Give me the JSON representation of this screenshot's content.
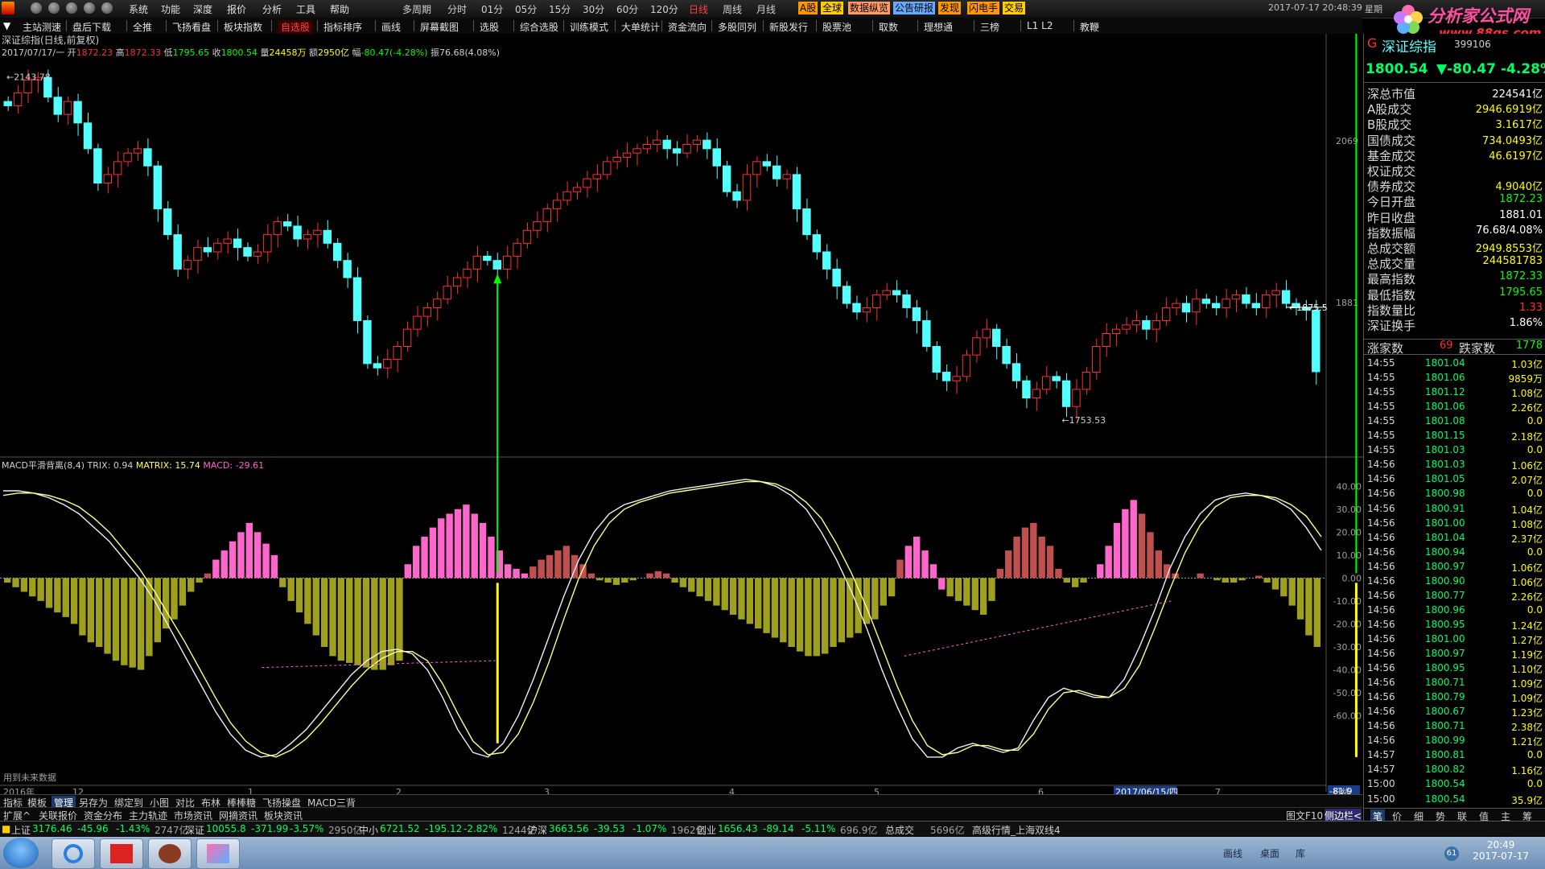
{
  "titlebar": {
    "menus": [
      "系统",
      "功能",
      "深度",
      "报价",
      "分析",
      "工具",
      "帮助"
    ],
    "periods": [
      "多周期",
      "分时",
      "01分",
      "05分",
      "15分",
      "30分",
      "60分",
      "120分",
      "日线",
      "周线",
      "月线"
    ],
    "active_period": "日线",
    "tags": [
      {
        "label": "A股",
        "bg": "#ff9900"
      },
      {
        "label": "全球",
        "bg": "#ffcc00"
      },
      {
        "label": "数据纵览",
        "bg": "#ff9966"
      },
      {
        "label": "公告研报",
        "bg": "#66aaff"
      },
      {
        "label": "发现",
        "bg": "#ff9900"
      },
      {
        "label": "闪电手",
        "bg": "#ff9900"
      },
      {
        "label": "交易",
        "bg": "#ffcc00"
      }
    ],
    "datetime": "2017-07-17  20:48:39",
    "weekday": "星期"
  },
  "logo": {
    "text": "分析家公式网",
    "url": "www.88gs.com"
  },
  "toolbar": [
    "主站测速",
    "盘后下载",
    "全推",
    "飞扬看盘",
    "板块指数",
    "自选股",
    "指标排序",
    "画线",
    "屏幕截图",
    "选股",
    "综合选股",
    "训练模式",
    "大单统计",
    "资金流向",
    "多股同列",
    "新股发行",
    "股票池",
    "取数",
    "理想通",
    "三榜",
    "L1 L2",
    "教鞭"
  ],
  "toolbar_active": "自选股",
  "chart": {
    "stock_title": "深证综指(日线,前复权)",
    "ohlc_line": {
      "date": "2017/07/17/一",
      "open_label": "开",
      "open": "1872.23",
      "high_label": "高",
      "high": "1872.33",
      "low_label": "低",
      "low": "1795.65",
      "close_label": "收",
      "close": "1800.54",
      "vol_label": "量",
      "vol": "24458万",
      "amount_label": "额",
      "amount": "2950亿",
      "chg_label": "幅",
      "chg": "-80.47(-4.28%)",
      "amp_label": "振",
      "amp": "76.68(4.08%)"
    },
    "max_marker": "2143.78",
    "min_marker": "1753.53",
    "last_marker": "1875.5",
    "price_ticks": [
      "2069",
      "1881"
    ],
    "indicator_title": "MACD平滑背离(8,4)",
    "trix_label": "TRIX:",
    "trix": "0.94",
    "matrix_label": "MATRIX:",
    "matrix": "15.74",
    "macd_label": "MACD:",
    "macd": "-29.61",
    "indicator_ticks": [
      "40.00",
      "30.00",
      "20.00",
      "10.00",
      "0.00",
      "-10.00",
      "-20.00",
      "-30.00",
      "-40.00",
      "-50.00",
      "-60.00"
    ],
    "indicator_current": "-81.9",
    "future_note": "用到未来数据",
    "year_label": "2016年",
    "month_labels": [
      "12",
      "1",
      "2",
      "3",
      "4",
      "5",
      "6",
      "7"
    ],
    "cursor_date": "2017/06/15/四",
    "period_tag": "日线"
  },
  "chart_data": {
    "type": "candlestick",
    "title": "深证综指(日线,前复权)",
    "price_range": [
      1753.53,
      2143.78
    ],
    "candles_close": [
      2110,
      2125,
      2140,
      2143,
      2120,
      2100,
      2115,
      2090,
      2060,
      2020,
      2030,
      2045,
      2055,
      2060,
      2040,
      1990,
      1960,
      1920,
      1930,
      1945,
      1940,
      1950,
      1955,
      1945,
      1935,
      1940,
      1960,
      1975,
      1970,
      1955,
      1960,
      1965,
      1950,
      1930,
      1910,
      1860,
      1810,
      1805,
      1815,
      1830,
      1850,
      1865,
      1875,
      1885,
      1900,
      1910,
      1920,
      1935,
      1930,
      1920,
      1935,
      1950,
      1965,
      1975,
      1990,
      2000,
      2010,
      2015,
      2025,
      2030,
      2045,
      2050,
      2055,
      2060,
      2065,
      2070,
      2060,
      2055,
      2065,
      2070,
      2060,
      2040,
      2010,
      2000,
      2030,
      2045,
      2040,
      2025,
      2030,
      1990,
      1960,
      1940,
      1920,
      1900,
      1880,
      1870,
      1875,
      1890,
      1895,
      1890,
      1875,
      1860,
      1830,
      1800,
      1790,
      1795,
      1820,
      1840,
      1850,
      1830,
      1810,
      1790,
      1770,
      1780,
      1795,
      1790,
      1760,
      1780,
      1800,
      1830,
      1845,
      1850,
      1855,
      1860,
      1850,
      1860,
      1875,
      1880,
      1870,
      1885,
      1880,
      1875,
      1885,
      1890,
      1880,
      1875,
      1890,
      1895,
      1880,
      1875,
      1872,
      1800.54
    ],
    "indicator": {
      "name": "MACD平滑背离(8,4)",
      "TRIX": 0.94,
      "MATRIX": 15.74,
      "MACD": -29.61,
      "y_range": [
        -81.9,
        45
      ],
      "macd_hist": [
        -2,
        -4,
        -6,
        -8,
        -10,
        -13,
        -15,
        -17,
        -20,
        -25,
        -28,
        -30,
        -33,
        -36,
        -38,
        -39,
        -40,
        -34,
        -28,
        -22,
        -18,
        -12,
        -6,
        -2,
        2,
        8,
        12,
        16,
        20,
        24,
        20,
        15,
        10,
        -4,
        -10,
        -15,
        -20,
        -25,
        -30,
        -34,
        -36,
        -37,
        -38,
        -39,
        -40,
        -40,
        -38,
        -36,
        6,
        14,
        18,
        22,
        26,
        28,
        30,
        32,
        28,
        24,
        18,
        12,
        6,
        4,
        2,
        5,
        8,
        10,
        12,
        14,
        10,
        6,
        2,
        -1,
        -2,
        -3,
        -2,
        -1,
        0,
        2,
        3,
        2,
        -2,
        -4,
        -6,
        -8,
        -10,
        -12,
        -14,
        -16,
        -18,
        -20,
        -22,
        -24,
        -26,
        -28,
        -30,
        -32,
        -34,
        -34,
        -33,
        -30,
        -28,
        -26,
        -24,
        -20,
        -18,
        -12,
        -8,
        8,
        14,
        18,
        12,
        6,
        -5,
        -8,
        -10,
        -12,
        -14,
        -16,
        -10,
        4,
        12,
        18,
        22,
        24,
        18,
        14,
        4,
        -2,
        -4,
        -2,
        0,
        6,
        14,
        24,
        30,
        34,
        28,
        20,
        12,
        6,
        2,
        0,
        0,
        2,
        0,
        -1,
        -2,
        -2,
        -1,
        0,
        1,
        -2,
        -5,
        -8,
        -12,
        -18,
        -25,
        -30
      ],
      "trix_curve": [
        38,
        38,
        37,
        35,
        32,
        28,
        22,
        16,
        8,
        0,
        -10,
        -22,
        -34,
        -46,
        -58,
        -68,
        -75,
        -78,
        -77,
        -72,
        -66,
        -58,
        -50,
        -42,
        -36,
        -32,
        -31,
        -33,
        -40,
        -52,
        -66,
        -76,
        -78,
        -72,
        -60,
        -44,
        -26,
        -8,
        8,
        20,
        28,
        32,
        34,
        36,
        38,
        39,
        40,
        41,
        42,
        43,
        42,
        40,
        36,
        30,
        20,
        8,
        -6,
        -22,
        -40,
        -56,
        -70,
        -78,
        -78,
        -74,
        -72,
        -74,
        -76,
        -74,
        -62,
        -52,
        -48,
        -50,
        -52,
        -52,
        -44,
        -30,
        -14,
        4,
        18,
        28,
        34,
        36,
        37,
        36,
        34,
        30,
        22,
        12
      ],
      "matrix_curve": [
        36,
        37,
        37,
        36,
        34,
        31,
        26,
        20,
        12,
        4,
        -6,
        -17,
        -28,
        -40,
        -52,
        -63,
        -71,
        -76,
        -78,
        -75,
        -70,
        -63,
        -55,
        -47,
        -40,
        -35,
        -32,
        -32,
        -36,
        -46,
        -59,
        -71,
        -77,
        -76,
        -68,
        -54,
        -37,
        -18,
        0,
        14,
        24,
        30,
        33,
        35,
        37,
        38,
        39,
        40,
        41,
        42,
        42,
        41,
        38,
        33,
        26,
        15,
        2,
        -13,
        -30,
        -47,
        -62,
        -73,
        -77,
        -76,
        -73,
        -73,
        -75,
        -75,
        -68,
        -57,
        -50,
        -49,
        -51,
        -52,
        -48,
        -38,
        -22,
        -5,
        11,
        23,
        31,
        35,
        36,
        36,
        35,
        32,
        27,
        18
      ]
    },
    "buy_arrows": [
      49,
      135,
      146
    ]
  },
  "right_panel": {
    "index_code_label": "G",
    "index_name": "深证综指",
    "index_code": "399106",
    "price": "1800.54",
    "change": "▼-80.47",
    "change_pct": "-4.28%",
    "stats": [
      {
        "label": "深总市值",
        "value": "224541亿",
        "color": "#ffffff"
      },
      {
        "label": "A股成交",
        "value": "2946.6919亿",
        "color": "#ffff00"
      },
      {
        "label": "B股成交",
        "value": "3.1617亿",
        "color": "#ffff00"
      },
      {
        "label": "国债成交",
        "value": "734.0493亿",
        "color": "#ffff00"
      },
      {
        "label": "基金成交",
        "value": "46.6197亿",
        "color": "#ffff00"
      },
      {
        "label": "权证成交",
        "value": "",
        "color": "#ffff00"
      },
      {
        "label": "债券成交",
        "value": "4.9040亿",
        "color": "#ffff00"
      },
      {
        "label": "今日开盘",
        "value": "1872.23",
        "color": "#00ff00"
      },
      {
        "label": "昨日收盘",
        "value": "1881.01",
        "color": "#ffffff"
      },
      {
        "label": "指数振幅",
        "value": "76.68/4.08%",
        "color": "#ffffff"
      },
      {
        "label": "总成交额",
        "value": "2949.8553亿",
        "color": "#ffff00"
      },
      {
        "label": "总成交量",
        "value": "244581783",
        "color": "#ffff00"
      },
      {
        "label": "最高指数",
        "value": "1872.33",
        "color": "#00ff00"
      },
      {
        "label": "最低指数",
        "value": "1795.65",
        "color": "#00ff00"
      },
      {
        "label": "指数量比",
        "value": "1.33",
        "color": "#ff3030"
      },
      {
        "label": "深证换手",
        "value": "1.86%",
        "color": "#ffffff"
      }
    ],
    "rise_label": "涨家数",
    "rise_count": "69",
    "fall_label": "跌家数",
    "fall_count": "1778",
    "ticks": [
      {
        "t": "14:55",
        "p": "1801.04",
        "v": "1.03亿"
      },
      {
        "t": "14:55",
        "p": "1801.06",
        "v": "9859万"
      },
      {
        "t": "14:55",
        "p": "1801.12",
        "v": "1.08亿"
      },
      {
        "t": "14:55",
        "p": "1801.06",
        "v": "2.26亿"
      },
      {
        "t": "14:55",
        "p": "1801.08",
        "v": "0.0"
      },
      {
        "t": "14:55",
        "p": "1801.15",
        "v": "2.18亿"
      },
      {
        "t": "14:55",
        "p": "1801.03",
        "v": "0.0"
      },
      {
        "t": "14:56",
        "p": "1801.03",
        "v": "1.06亿"
      },
      {
        "t": "14:56",
        "p": "1801.05",
        "v": "2.07亿"
      },
      {
        "t": "14:56",
        "p": "1800.98",
        "v": "0.0"
      },
      {
        "t": "14:56",
        "p": "1800.91",
        "v": "1.04亿"
      },
      {
        "t": "14:56",
        "p": "1801.00",
        "v": "1.08亿"
      },
      {
        "t": "14:56",
        "p": "1801.04",
        "v": "2.37亿"
      },
      {
        "t": "14:56",
        "p": "1800.94",
        "v": "0.0"
      },
      {
        "t": "14:56",
        "p": "1800.97",
        "v": "1.06亿"
      },
      {
        "t": "14:56",
        "p": "1800.90",
        "v": "1.06亿"
      },
      {
        "t": "14:56",
        "p": "1800.77",
        "v": "2.26亿"
      },
      {
        "t": "14:56",
        "p": "1800.96",
        "v": "0.0"
      },
      {
        "t": "14:56",
        "p": "1800.95",
        "v": "1.24亿"
      },
      {
        "t": "14:56",
        "p": "1801.00",
        "v": "1.27亿"
      },
      {
        "t": "14:56",
        "p": "1800.97",
        "v": "1.19亿"
      },
      {
        "t": "14:56",
        "p": "1800.95",
        "v": "1.10亿"
      },
      {
        "t": "14:56",
        "p": "1800.71",
        "v": "1.09亿"
      },
      {
        "t": "14:56",
        "p": "1800.79",
        "v": "1.09亿"
      },
      {
        "t": "14:56",
        "p": "1800.67",
        "v": "1.23亿"
      },
      {
        "t": "14:56",
        "p": "1800.71",
        "v": "2.38亿"
      },
      {
        "t": "14:56",
        "p": "1800.99",
        "v": "1.21亿"
      },
      {
        "t": "14:57",
        "p": "1800.81",
        "v": "0.0"
      },
      {
        "t": "14:57",
        "p": "1800.82",
        "v": "1.16亿"
      },
      {
        "t": "15:00",
        "p": "1800.54",
        "v": "0.0"
      },
      {
        "t": "15:00",
        "p": "1800.54",
        "v": "35.9亿"
      }
    ],
    "bottom_tabs": [
      "笔",
      "价",
      "细",
      "势",
      "联",
      "值",
      "主",
      "筹"
    ]
  },
  "bottom_tabs1": [
    "指标",
    "模板",
    "管理",
    "另存为",
    "绑定到",
    "小图",
    "对比",
    "布林",
    "棒棒糖",
    "飞扬操盘",
    "MACD三背"
  ],
  "bottom_tabs1_active": "管理",
  "bottom_tabs2": [
    "扩展^",
    "关联报价",
    "资金分布",
    "主力轨迹",
    "市场资讯",
    "网摘资讯",
    "板块资讯"
  ],
  "bottom_right_tabs": [
    "图文F10",
    "侧边栏<"
  ],
  "statusbar": [
    {
      "name": "上证",
      "val": "3176.46",
      "chg": "-45.96",
      "pct": "-1.43%",
      "amt": "2747亿"
    },
    {
      "name": "深证",
      "val": "10055.8",
      "chg": "-371.99",
      "pct": "-3.57%",
      "amt": "2950亿"
    },
    {
      "name": "中小",
      "val": "6721.52",
      "chg": "-195.12",
      "pct": "-2.82%",
      "amt": "1244亿"
    },
    {
      "name": "沪深",
      "val": "3663.56",
      "chg": "-39.53",
      "pct": "-1.07%",
      "amt": "1962亿"
    },
    {
      "name": "创业",
      "val": "1656.43",
      "chg": "-89.14",
      "pct": "-5.11%",
      "amt": "696.9亿"
    }
  ],
  "status_total_label": "总成交",
  "status_total": "5696亿",
  "status_feed": "高级行情_上海双线4",
  "taskbar": {
    "tray_items": [
      "画线",
      "桌面",
      "库"
    ],
    "clock_time": "20:49",
    "clock_date": "2017-07-17",
    "badge": "61"
  },
  "colors": {
    "up": "#ff3030",
    "down": "#54ffff",
    "magenta": "#ff66cc",
    "olive": "#a0a020",
    "yellow": "#ffff00",
    "green": "#00ff00"
  }
}
